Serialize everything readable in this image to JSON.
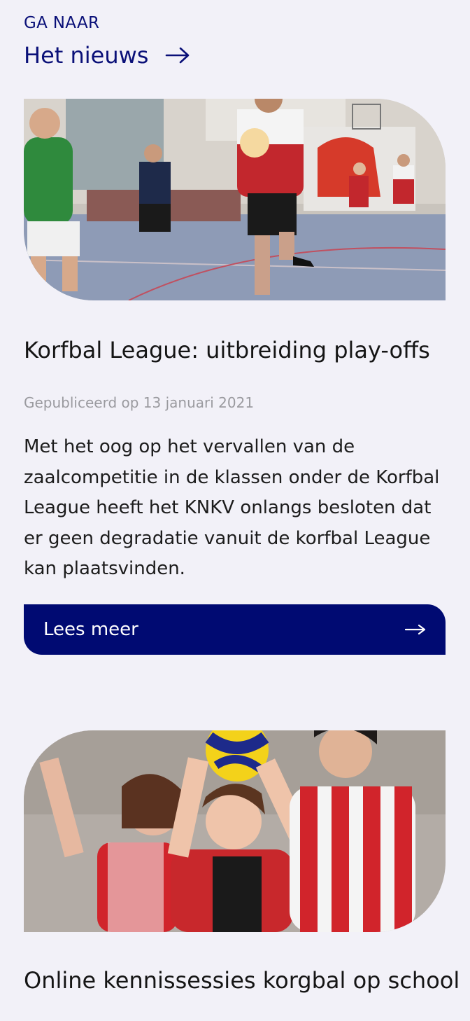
{
  "goto": {
    "label": "GA NAAR",
    "link_label": "Het nieuws",
    "icon": "arrow-right-icon"
  },
  "articles": [
    {
      "image": "korfbal-match-photo",
      "title": "Korfbal League: uitbreiding play-offs",
      "date": "Gepubliceerd op 13 januari 2021",
      "excerpt": "Met het oog op het vervallen van de zaalcompetitie in de klassen onder de Korfbal League heeft het KNKV onlangs besloten dat er geen degradatie vanuit de korfbal League kan plaatsvinden.",
      "button_label": "Lees meer",
      "button_icon": "arrow-right-icon"
    },
    {
      "image": "korfbal-youth-players-photo",
      "title": "Online kennissessies korgbal op school"
    }
  ],
  "colors": {
    "background": "#f2f1f8",
    "accent": "#000a72",
    "link": "#0a1078",
    "muted": "#9a9a9f"
  }
}
